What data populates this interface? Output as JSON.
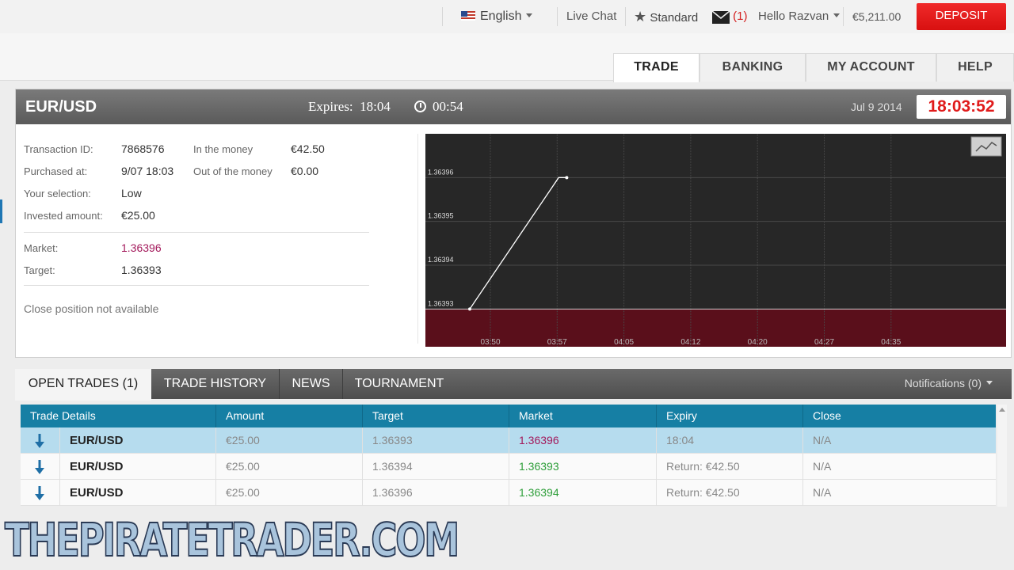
{
  "topbar": {
    "language": "English",
    "live_chat": "Live Chat",
    "account_type": "Standard",
    "messages_count": "(1)",
    "greeting": "Hello Razvan",
    "balance": "€5,211.00",
    "deposit": "DEPOSIT"
  },
  "nav": {
    "tabs": [
      "TRADE",
      "BANKING",
      "MY ACCOUNT",
      "HELP"
    ],
    "active": "TRADE"
  },
  "trade": {
    "symbol": "EUR/USD",
    "expires_label": "Expires:",
    "expires_time": "18:04",
    "countdown": "00:54",
    "date": "Jul 9 2014",
    "clock": "18:03:52",
    "details": {
      "transaction_id_label": "Transaction ID:",
      "transaction_id": "7868576",
      "purchased_at_label": "Purchased at:",
      "purchased_at": "9/07 18:03",
      "selection_label": "Your selection:",
      "selection": "Low",
      "invested_label": "Invested amount:",
      "invested": "€25.00",
      "in_money_label": "In the money",
      "in_money": "€42.50",
      "out_money_label": "Out of the money",
      "out_money": "€0.00",
      "market_label": "Market:",
      "market": "1.36396",
      "target_label": "Target:",
      "target": "1.36393",
      "close_note": "Close position not available"
    }
  },
  "chart_data": {
    "type": "line",
    "x_ticks": [
      "03:50",
      "03:57",
      "04:05",
      "04:12",
      "04:20",
      "04:27",
      "04:35"
    ],
    "y_ticks": [
      1.36393,
      1.36394,
      1.36395,
      1.36396
    ],
    "ylim": [
      1.363925,
      1.36397
    ],
    "series": [
      {
        "points": [
          [
            0.0,
            1.36393
          ],
          [
            0.33,
            1.36396
          ],
          [
            0.36,
            1.36396
          ]
        ]
      }
    ],
    "target": 1.36393,
    "colors": {
      "bg": "#272727",
      "below_target": "#5a0f1b",
      "line": "#ffffff",
      "grid": "#4a4a4a"
    }
  },
  "lower_tabs": {
    "tabs": [
      "OPEN TRADES (1)",
      "TRADE HISTORY",
      "NEWS",
      "TOURNAMENT"
    ],
    "notifications": "Notifications (0)"
  },
  "table": {
    "headers": [
      "Trade Details",
      "Amount",
      "Target",
      "Market",
      "Expiry",
      "Close"
    ],
    "rows": [
      {
        "symbol": "EUR/USD",
        "amount": "€25.00",
        "target": "1.36393",
        "market": "1.36396",
        "expiry": "18:04",
        "close": "N/A",
        "market_color": "#a3195b"
      },
      {
        "symbol": "EUR/USD",
        "amount": "€25.00",
        "target": "1.36394",
        "market": "1.36393",
        "expiry": "Return: €42.50",
        "close": "N/A",
        "market_color": "#2e9e3a"
      },
      {
        "symbol": "EUR/USD",
        "amount": "€25.00",
        "target": "1.36396",
        "market": "1.36394",
        "expiry": "Return: €42.50",
        "close": "N/A",
        "market_color": "#2e9e3a"
      }
    ]
  },
  "watermark": "THEPIRATETRADER.COM"
}
